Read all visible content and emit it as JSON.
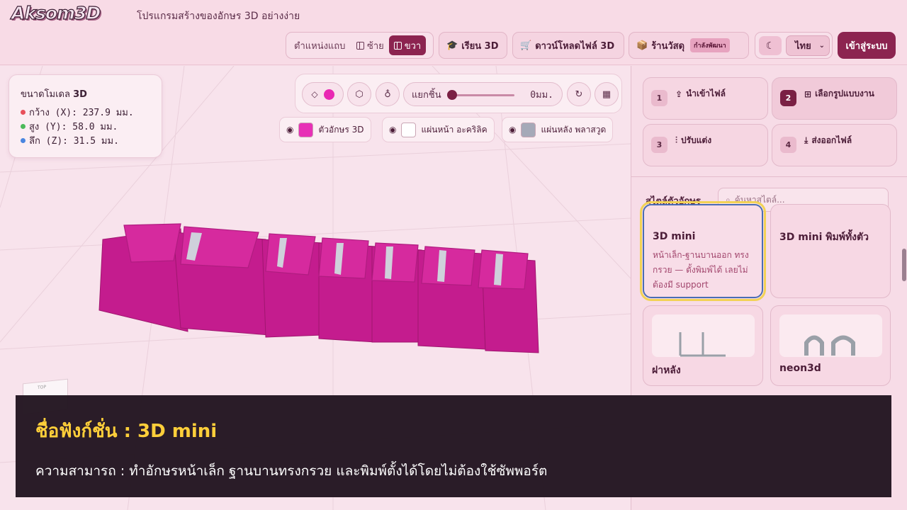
{
  "header": {
    "logo": "Aksom3D",
    "tagline": "โปรแกรมสร้างของอักษร 3D อย่างง่าย",
    "position_label": "ตำแหน่งแถบ",
    "position_left": "ซ้าย",
    "position_right": "ขวา",
    "learn": "เรียน 3D",
    "download": "ดาวน์โหลดไฟล์ 3D",
    "shop": "ร้านวัสดุ",
    "shop_badge": "กำลังพัฒนา",
    "theme_icon": "moon-icon",
    "language": "ไทย",
    "login": "เข้าสู่ระบบ"
  },
  "dimensions": {
    "title_prefix": "ขนาดโมเดล",
    "title_suffix": "3D",
    "width": "กว้าง (X): 237.9 มม.",
    "height": "สูง (Y): 58.0 มม.",
    "depth": "ลึก (Z): 31.5 มม.",
    "colors": {
      "x": "#e8505b",
      "y": "#4cba5a",
      "z": "#4a86e0"
    }
  },
  "toolbar": {
    "color_value": "#e928b3",
    "separate_label": "แยกชิ้น",
    "separate_value": "0มม.",
    "separate_level": 0
  },
  "layers": [
    {
      "label": "ตัวอักษร 3D",
      "color": "#e730b6"
    },
    {
      "label": "แผ่นหน้า อะคริลิค",
      "color": "#ffffff"
    },
    {
      "label": "แผ่นหลัง พลาสวูด",
      "color": "#a5a9b8"
    }
  ],
  "model": {
    "text": "3DMini",
    "face_color": "#d62a9e",
    "side_color": "#c41c8e"
  },
  "steps": [
    {
      "num": "1",
      "label": "นำเข้าไฟล์"
    },
    {
      "num": "2",
      "label": "เลือกรูปแบบงาน"
    },
    {
      "num": "3",
      "label": "ปรับแต่ง"
    },
    {
      "num": "4",
      "label": "ส่งออกไฟล์"
    }
  ],
  "styles": {
    "label": "สไตล์ตัวอักษร",
    "search_placeholder": "ค้นหาสไตล์...",
    "cards": [
      {
        "title": "3D mini",
        "desc": "หน้าเล็ก-ฐานบานออก ทรงกรวย — ตั้งพิมพ์ได้ เลยไม่ต้องมี support"
      },
      {
        "title": "3D mini พิมพ์ทั้งตัว"
      },
      {
        "title": "ฝาหลัง"
      },
      {
        "title": "neon3d"
      }
    ]
  },
  "caption": {
    "title": "ชื่อฟังก์ชั่น : 3D mini",
    "desc": "ความสามารถ : ทำอักษรหน้าเล็ก ฐานบานทรงกรวย และพิมพ์ตั้งได้โดยไม่ต้องใช้ซัพพอร์ต"
  }
}
